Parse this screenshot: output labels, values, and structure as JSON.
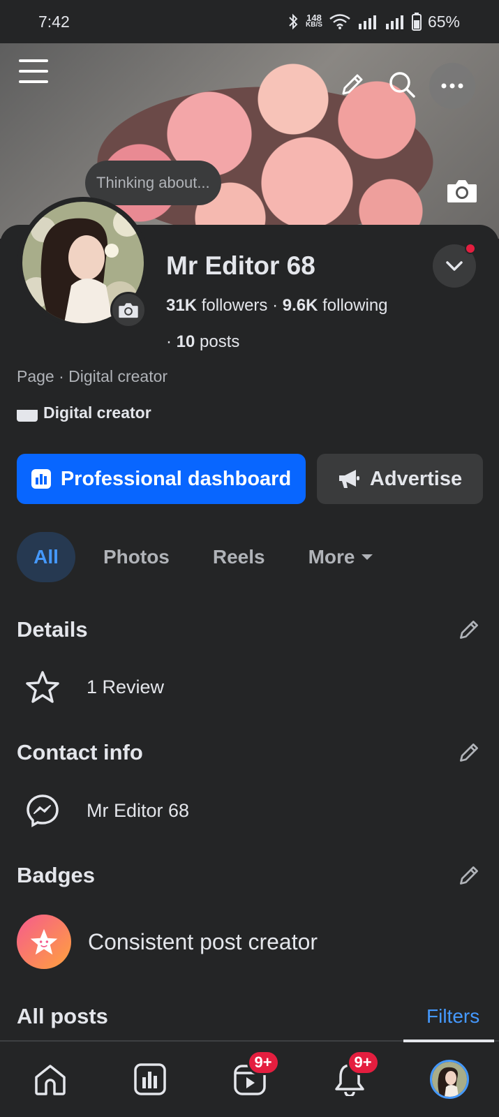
{
  "status_bar": {
    "time": "7:42",
    "net_speed_value": "148",
    "net_speed_unit": "KB/S",
    "battery": "65%"
  },
  "cover": {
    "thought_bubble": "Thinking about..."
  },
  "profile": {
    "name": "Mr Editor 68",
    "followers_count": "31K",
    "followers_label": "followers",
    "following_count": "9.6K",
    "following_label": "following",
    "posts_count": "10",
    "posts_label": "posts",
    "page_category": "Page · Digital creator",
    "creator_label": "Digital creator"
  },
  "actions": {
    "primary": "Professional dashboard",
    "secondary": "Advertise"
  },
  "tabs": [
    {
      "label": "All",
      "active": true
    },
    {
      "label": "Photos"
    },
    {
      "label": "Reels"
    },
    {
      "label": "More"
    }
  ],
  "details": {
    "title": "Details",
    "review": "1 Review"
  },
  "contact": {
    "title": "Contact info",
    "messenger": "Mr Editor 68"
  },
  "badges": {
    "title": "Badges",
    "item": "Consistent post creator"
  },
  "posts": {
    "title": "All posts",
    "filters": "Filters"
  },
  "bottom_nav": {
    "video_badge": "9+",
    "notifications_badge": "9+"
  },
  "colors": {
    "accent": "#0866ff",
    "link": "#4599ff",
    "background": "#242526",
    "alert": "#e41e3f"
  },
  "icons": [
    "bluetooth-icon",
    "wifi-icon",
    "signal-icon",
    "battery-icon",
    "hamburger-icon",
    "pencil-icon",
    "search-icon",
    "more-icon",
    "camera-icon",
    "chevron-down-icon",
    "clapperboard-icon",
    "bar-chart-icon",
    "megaphone-icon",
    "star-icon",
    "messenger-icon",
    "badge-star-icon",
    "home-icon",
    "video-icon",
    "bell-icon"
  ]
}
